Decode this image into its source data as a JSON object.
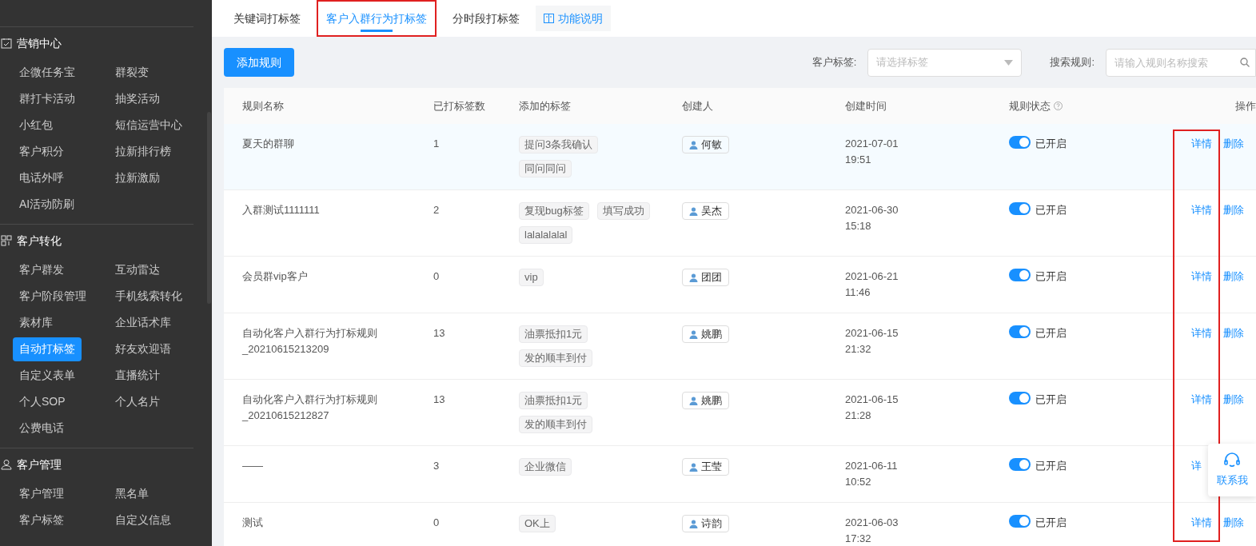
{
  "sidebar": {
    "sections": [
      {
        "title": "营销中心",
        "kind": "calendar",
        "items": [
          {
            "label": "企微任务宝",
            "selected": false
          },
          {
            "label": "群裂变",
            "selected": false
          },
          {
            "label": "群打卡活动",
            "selected": false
          },
          {
            "label": "抽奖活动",
            "selected": false
          },
          {
            "label": "小红包",
            "selected": false
          },
          {
            "label": "短信运营中心",
            "selected": false
          },
          {
            "label": "客户积分",
            "selected": false
          },
          {
            "label": "拉新排行榜",
            "selected": false
          },
          {
            "label": "电话外呼",
            "selected": false
          },
          {
            "label": "拉新激励",
            "selected": false
          },
          {
            "label": "AI活动防刷",
            "selected": false
          }
        ]
      },
      {
        "title": "客户转化",
        "kind": "nodes",
        "items": [
          {
            "label": "客户群发",
            "selected": false
          },
          {
            "label": "互动雷达",
            "selected": false
          },
          {
            "label": "客户阶段管理",
            "selected": false
          },
          {
            "label": "手机线索转化",
            "selected": false
          },
          {
            "label": "素材库",
            "selected": false
          },
          {
            "label": "企业话术库",
            "selected": false
          },
          {
            "label": "自动打标签",
            "selected": true
          },
          {
            "label": "好友欢迎语",
            "selected": false
          },
          {
            "label": "自定义表单",
            "selected": false
          },
          {
            "label": "直播统计",
            "selected": false
          },
          {
            "label": "个人SOP",
            "selected": false
          },
          {
            "label": "个人名片",
            "selected": false
          },
          {
            "label": "公费电话",
            "selected": false
          }
        ]
      },
      {
        "title": "客户管理",
        "kind": "user",
        "items": [
          {
            "label": "客户管理",
            "selected": false
          },
          {
            "label": "黑名单",
            "selected": false
          },
          {
            "label": "客户标签",
            "selected": false
          },
          {
            "label": "自定义信息",
            "selected": false
          }
        ]
      }
    ]
  },
  "tabs": [
    {
      "label": "关键词打标签",
      "selected": false,
      "highlighted": false
    },
    {
      "label": "客户入群行为打标签",
      "selected": true,
      "highlighted": true
    },
    {
      "label": "分时段打标签",
      "selected": false,
      "highlighted": false
    }
  ],
  "help_button": "功能说明",
  "add_button": "添加规则",
  "filters": {
    "tag_label": "客户标签:",
    "tag_placeholder": "请选择标签",
    "search_label": "搜索规则:",
    "search_placeholder": "请输入规则名称搜索"
  },
  "table": {
    "columns": [
      "规则名称",
      "已打标签数",
      "添加的标签",
      "创建人",
      "创建时间",
      "规则状态",
      "操作"
    ],
    "rows": [
      {
        "name": "夏天的群聊",
        "count": "1",
        "tags": [
          "提问3条我确认",
          "同问同问"
        ],
        "creator": "何敏",
        "date": "2021-07-01",
        "time": "19:51",
        "on": true,
        "status": "已开启",
        "actions": [
          "详情",
          "删除"
        ]
      },
      {
        "name": "入群测试1111111",
        "count": "2",
        "tags": [
          "复现bug标签",
          "填写成功",
          "lalalalalal"
        ],
        "creator": "吴杰",
        "date": "2021-06-30",
        "time": "15:18",
        "on": true,
        "status": "已开启",
        "actions": [
          "详情",
          "删除"
        ]
      },
      {
        "name": "会员群vip客户",
        "count": "0",
        "tags": [
          "vip"
        ],
        "creator": "团团",
        "date": "2021-06-21",
        "time": "11:46",
        "on": true,
        "status": "已开启",
        "actions": [
          "详情",
          "删除"
        ]
      },
      {
        "name": "自动化客户入群行为打标规则_20210615213209",
        "count": "13",
        "tags": [
          "油票抵扣1元",
          "发的顺丰到付"
        ],
        "creator": "姚鹏",
        "date": "2021-06-15",
        "time": "21:32",
        "on": true,
        "status": "已开启",
        "actions": [
          "详情",
          "删除"
        ]
      },
      {
        "name": "自动化客户入群行为打标规则_20210615212827",
        "count": "13",
        "tags": [
          "油票抵扣1元",
          "发的顺丰到付"
        ],
        "creator": "姚鹏",
        "date": "2021-06-15",
        "time": "21:28",
        "on": true,
        "status": "已开启",
        "actions": [
          "详情",
          "删除"
        ]
      },
      {
        "name": "——",
        "count": "3",
        "tags": [
          "企业微信"
        ],
        "creator": "王莹",
        "date": "2021-06-11",
        "time": "10:52",
        "on": true,
        "status": "已开启",
        "actions": [
          "详"
        ]
      },
      {
        "name": "测试",
        "count": "0",
        "tags": [
          "OK上"
        ],
        "creator": "诗韵",
        "date": "2021-06-03",
        "time": "17:32",
        "on": true,
        "status": "已开启",
        "actions": [
          "详情",
          "删除"
        ]
      }
    ]
  },
  "contact_widget": "联系我"
}
